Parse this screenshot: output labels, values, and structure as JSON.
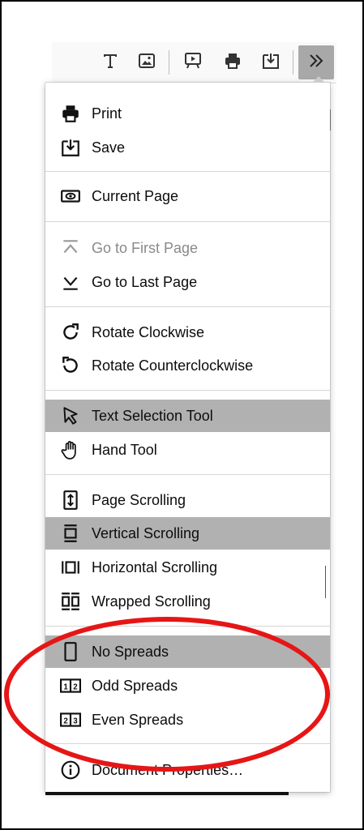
{
  "toolbar": {
    "buttons": [
      {
        "name": "text-tool-icon"
      },
      {
        "name": "image-tool-icon"
      },
      {
        "name": "presentation-mode-icon"
      },
      {
        "name": "print-icon"
      },
      {
        "name": "download-icon"
      },
      {
        "name": "tools-menu-icon"
      }
    ]
  },
  "menu": {
    "items": [
      {
        "label": "Print",
        "icon": "print-icon"
      },
      {
        "label": "Save",
        "icon": "save-icon"
      },
      {
        "label": "Current Page",
        "icon": "eye-icon"
      },
      {
        "label": "Go to First Page",
        "icon": "first-page-icon",
        "disabled": true
      },
      {
        "label": "Go to Last Page",
        "icon": "last-page-icon"
      },
      {
        "label": "Rotate Clockwise",
        "icon": "rotate-cw-icon"
      },
      {
        "label": "Rotate Counterclockwise",
        "icon": "rotate-ccw-icon"
      },
      {
        "label": "Text Selection Tool",
        "icon": "cursor-icon",
        "selected": true
      },
      {
        "label": "Hand Tool",
        "icon": "hand-icon"
      },
      {
        "label": "Page Scrolling",
        "icon": "page-scroll-icon"
      },
      {
        "label": "Vertical Scrolling",
        "icon": "vertical-scroll-icon",
        "selected": true
      },
      {
        "label": "Horizontal Scrolling",
        "icon": "horizontal-scroll-icon"
      },
      {
        "label": "Wrapped Scrolling",
        "icon": "wrapped-scroll-icon"
      },
      {
        "label": "No Spreads",
        "icon": "no-spreads-icon",
        "selected": true
      },
      {
        "label": "Odd Spreads",
        "icon": "odd-spreads-icon"
      },
      {
        "label": "Even Spreads",
        "icon": "even-spreads-icon"
      },
      {
        "label": "Document Properties…",
        "icon": "info-icon"
      }
    ]
  },
  "annotation": {
    "color": "#e61616"
  }
}
